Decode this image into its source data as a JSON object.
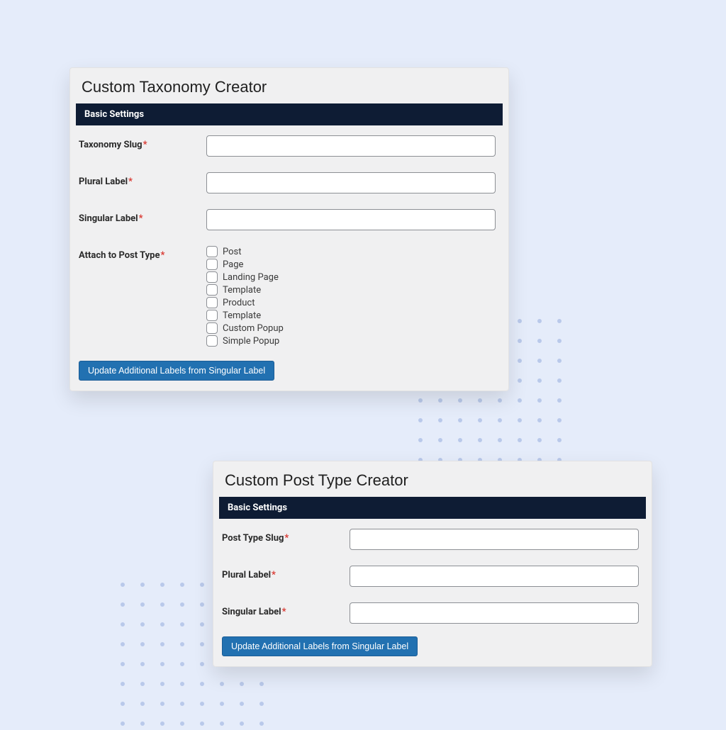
{
  "taxonomy_panel": {
    "title": "Custom Taxonomy Creator",
    "section": "Basic Settings",
    "fields": {
      "slug": {
        "label": "Taxonomy Slug",
        "required_marker": "*",
        "value": ""
      },
      "plural": {
        "label": "Plural Label",
        "required_marker": "*",
        "value": ""
      },
      "singular": {
        "label": "Singular Label",
        "required_marker": "*",
        "value": ""
      },
      "attach": {
        "label": "Attach to Post Type",
        "required_marker": "*",
        "options": [
          {
            "label": "Post",
            "checked": false
          },
          {
            "label": "Page",
            "checked": false
          },
          {
            "label": "Landing Page",
            "checked": false
          },
          {
            "label": "Template",
            "checked": false
          },
          {
            "label": "Product",
            "checked": false
          },
          {
            "label": "Template",
            "checked": false
          },
          {
            "label": "Custom Popup",
            "checked": false
          },
          {
            "label": "Simple Popup",
            "checked": false
          }
        ]
      }
    },
    "button": "Update Additional Labels from Singular Label"
  },
  "posttype_panel": {
    "title": "Custom Post Type Creator",
    "section": "Basic Settings",
    "fields": {
      "slug": {
        "label": "Post Type Slug",
        "required_marker": "*",
        "value": ""
      },
      "plural": {
        "label": "Plural Label",
        "required_marker": "*",
        "value": ""
      },
      "singular": {
        "label": "Singular Label",
        "required_marker": "*",
        "value": ""
      }
    },
    "button": "Update Additional Labels from Singular Label"
  },
  "colors": {
    "page_bg": "#e5ecfa",
    "panel_bg": "#f0f0f1",
    "header_bar": "#0e1c34",
    "button_primary": "#2271b1",
    "required": "#d9362f",
    "dot": "#b9c9ea"
  }
}
